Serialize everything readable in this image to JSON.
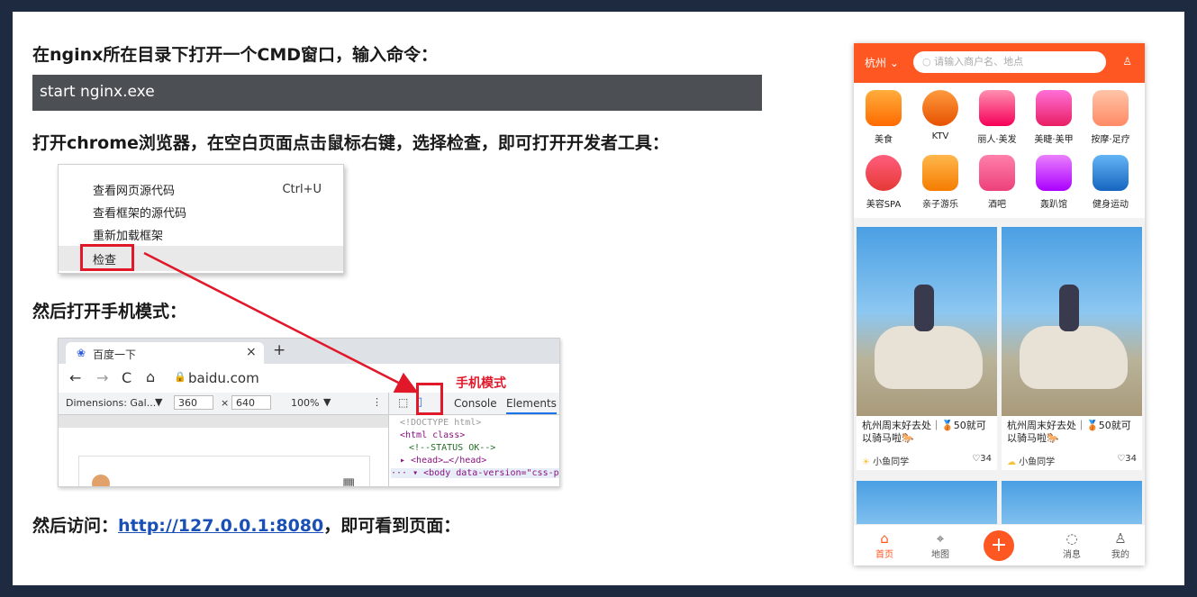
{
  "doc": {
    "heading1": "在nginx所在目录下打开一个CMD窗口，输入命令：",
    "command": "start nginx.exe",
    "heading2": "打开chrome浏览器，在空白页面点击鼠标右键，选择检查，即可打开开发者工具：",
    "heading3": "然后打开手机模式：",
    "heading4_prefix": "然后访问：",
    "heading4_link": "http://127.0.0.1:8080",
    "heading4_suffix": "，即可看到页面："
  },
  "context_menu": {
    "items": [
      "查看网页源代码",
      "查看框架的源代码",
      "重新加载框架",
      "检查"
    ],
    "shortcut": "Ctrl+U"
  },
  "browser": {
    "tab_title": "百度一下",
    "tab_close": "×",
    "new_tab": "+",
    "url": "baidu.com",
    "dimensions": "Dimensions: Gal...",
    "width": "360",
    "times": "×",
    "height": "640",
    "zoom": "100%",
    "devtools_tabs": [
      "Console",
      "Elements"
    ],
    "code_lines": [
      "<!DOCTYPE html>",
      "<html class>",
      "<!--STATUS OK-->",
      "▸ <head>…</head>",
      "··· ▾ <body data-version=\"css-page"
    ],
    "mobile_mode_label": "手机模式"
  },
  "phone": {
    "city": "杭州",
    "search_placeholder": "请输入商户名、地点",
    "categories": [
      "美食",
      "KTV",
      "丽人·美发",
      "美睫·美甲",
      "按摩·足疗",
      "美容SPA",
      "亲子游乐",
      "酒吧",
      "轰趴馆",
      "健身运动"
    ],
    "cards": [
      {
        "title": "杭州周末好去处｜🥉50就可以骑马啦🐎",
        "user": "小鱼同学",
        "likes": "34"
      },
      {
        "title": "杭州周末好去处｜🥉50就可以骑马啦🐎",
        "user": "小鱼同学",
        "likes": "34"
      }
    ],
    "nav": [
      "首页",
      "地图",
      "消息",
      "我的"
    ]
  },
  "colors": {
    "accent": "#ff5722",
    "highlight_red": "#e0182a",
    "link": "#1a4fb5",
    "frame": "#1d2a3f"
  }
}
